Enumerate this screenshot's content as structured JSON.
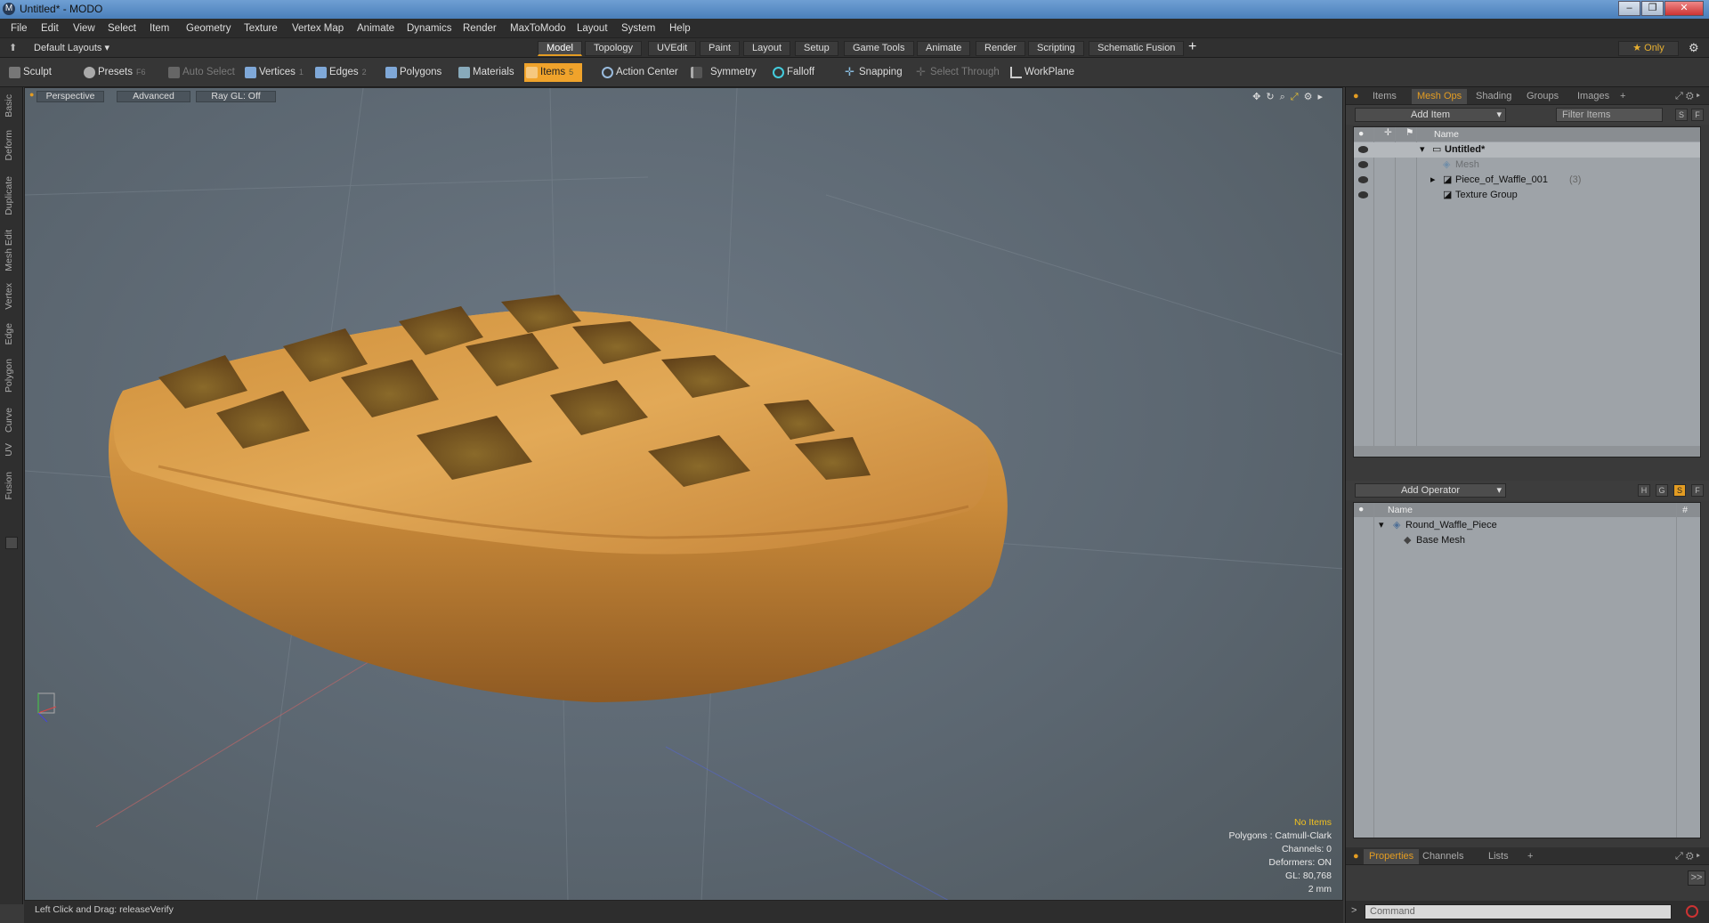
{
  "window": {
    "title": "Untitled* - MODO",
    "app_icon": "modo-icon",
    "controls": [
      "minimize",
      "maximize",
      "close"
    ]
  },
  "menu": [
    "File",
    "Edit",
    "View",
    "Select",
    "Item",
    "Geometry",
    "Texture",
    "Vertex Map",
    "Animate",
    "Dynamics",
    "Render",
    "MaxToModo",
    "Layout",
    "System",
    "Help"
  ],
  "layout_bar": {
    "layouts_dropdown": "Default Layouts ▾",
    "tabs": [
      "Model",
      "Topology",
      "UVEdit",
      "Paint",
      "Layout",
      "Setup",
      "Game Tools",
      "Animate",
      "Render",
      "Scripting",
      "Schematic Fusion"
    ],
    "active_tab": "Model",
    "add_label": "+",
    "only_label": "★  Only",
    "gear_icon": "gear-icon"
  },
  "toolbar": {
    "sculpt": "Sculpt",
    "presets": "Presets",
    "presets_key": "F6",
    "auto_select": "Auto Select",
    "vertices": "Vertices",
    "vertices_key": "1",
    "edges": "Edges",
    "edges_key": "2",
    "polygons": "Polygons",
    "materials": "Materials",
    "items": "Items",
    "items_key": "5",
    "action_center": "Action Center",
    "symmetry": "Symmetry",
    "falloff": "Falloff",
    "snapping": "Snapping",
    "select_through": "Select Through",
    "workplane": "WorkPlane"
  },
  "left_tabs": [
    "Basic",
    "Deform",
    "Duplicate",
    "Mesh Edit",
    "Vertex",
    "Edge",
    "Polygon",
    "Curve",
    "UV",
    "Fusion"
  ],
  "viewport": {
    "view_label": "Perspective",
    "advanced_label": "Advanced",
    "raygl_label": "Ray GL: Off",
    "info": {
      "selection": "No Items",
      "polygons": "Polygons : Catmull-Clark",
      "channels": "Channels: 0",
      "deformers": "Deformers: ON",
      "gl": "GL: 80,768",
      "unit": "2 mm"
    },
    "colors": {
      "bg": "#5f6b75",
      "waffle_light": "#e0a04a",
      "waffle_dark": "#a4621f",
      "waffle_hole": "#7a4f1c"
    }
  },
  "status": "Left Click and Drag:  releaseVerify",
  "items_panel": {
    "tabs": [
      "Items",
      "Mesh Ops",
      "Shading",
      "Groups",
      "Images",
      "+"
    ],
    "active_tab": "Mesh Ops",
    "add_item": "Add Item",
    "filter_placeholder": "Filter Items",
    "s_btn": "S",
    "f_btn": "F",
    "column_name": "Name",
    "tree": [
      {
        "label": "Untitled*",
        "depth": 0,
        "expanded": true
      },
      {
        "label": "Mesh",
        "depth": 1,
        "dim": true
      },
      {
        "label": "Piece_of_Waffle_001",
        "count": "(3)",
        "depth": 1,
        "collapsed": true
      },
      {
        "label": "Texture Group",
        "depth": 1
      }
    ]
  },
  "meshops_panel": {
    "add_operator": "Add Operator",
    "h_btn": "H",
    "g_btn": "G",
    "s_btn": "S",
    "f_btn": "F",
    "column_name": "Name",
    "column_hash": "#",
    "tree": [
      {
        "label": "Round_Waffle_Piece",
        "depth": 0
      },
      {
        "label": "Base Mesh",
        "depth": 1
      }
    ]
  },
  "properties_panel": {
    "tabs": [
      "Properties",
      "Channels",
      "Lists",
      "+"
    ],
    "active_tab": "Properties",
    "expand_label": ">>"
  },
  "command": {
    "arrow": ">",
    "placeholder": "Command"
  }
}
